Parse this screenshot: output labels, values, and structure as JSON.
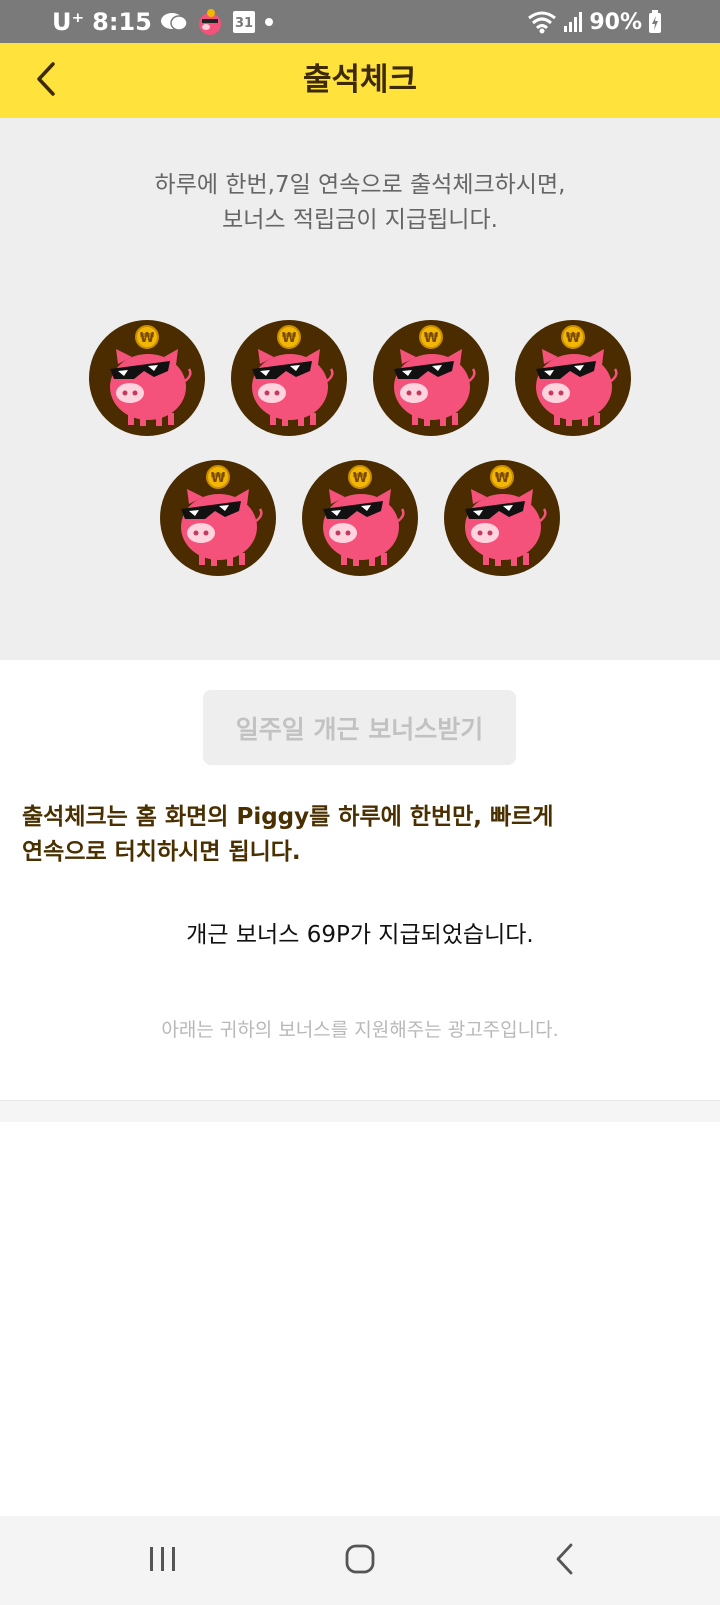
{
  "status_bar": {
    "carrier": "U⁺",
    "time": "8:15",
    "battery": "90%",
    "icons": [
      "chat-bubble-icon",
      "piggy-app-icon",
      "calendar-icon",
      "notification-dot-icon",
      "wifi-icon",
      "signal-icon",
      "battery-charging-icon"
    ]
  },
  "header": {
    "title": "출석체크",
    "back_icon": "chevron-left-icon",
    "background": "#ffe23b"
  },
  "intro": {
    "line1": "하루에 한번,7일 연속으로 출석체크하시면,",
    "line2": "보너스 적립금이 지급됩니다."
  },
  "attendance": {
    "days": [
      {
        "icon": "piggy-sunglasses-icon",
        "checked": true
      },
      {
        "icon": "piggy-sunglasses-icon",
        "checked": true
      },
      {
        "icon": "piggy-sunglasses-icon",
        "checked": true
      },
      {
        "icon": "piggy-sunglasses-icon",
        "checked": true
      },
      {
        "icon": "piggy-sunglasses-icon",
        "checked": true
      },
      {
        "icon": "piggy-sunglasses-icon",
        "checked": true
      },
      {
        "icon": "piggy-sunglasses-icon",
        "checked": true
      }
    ],
    "coin_symbol": "₩"
  },
  "bonus_button": {
    "label": "일주일 개근 보너스받기",
    "disabled": true
  },
  "instruction": {
    "line1": "출석체크는 홈 화면의 Piggy를 하루에 한번만, 빠르게",
    "line2": "연속으로 터치하시면 됩니다."
  },
  "granted_message": "개근 보너스 69P가 지급되었습니다.",
  "ad_note": "아래는 귀하의 보너스를 지원해주는 광고주입니다.",
  "nav_bar": {
    "recent_icon": "recent-apps-icon",
    "home_icon": "home-icon",
    "back_icon": "back-icon"
  },
  "colors": {
    "accent_yellow": "#ffe23b",
    "pig_pink": "#f4527a",
    "badge_brown": "#4a2c00",
    "coin_gold": "#f2b705",
    "text_brown": "#4a3000"
  }
}
